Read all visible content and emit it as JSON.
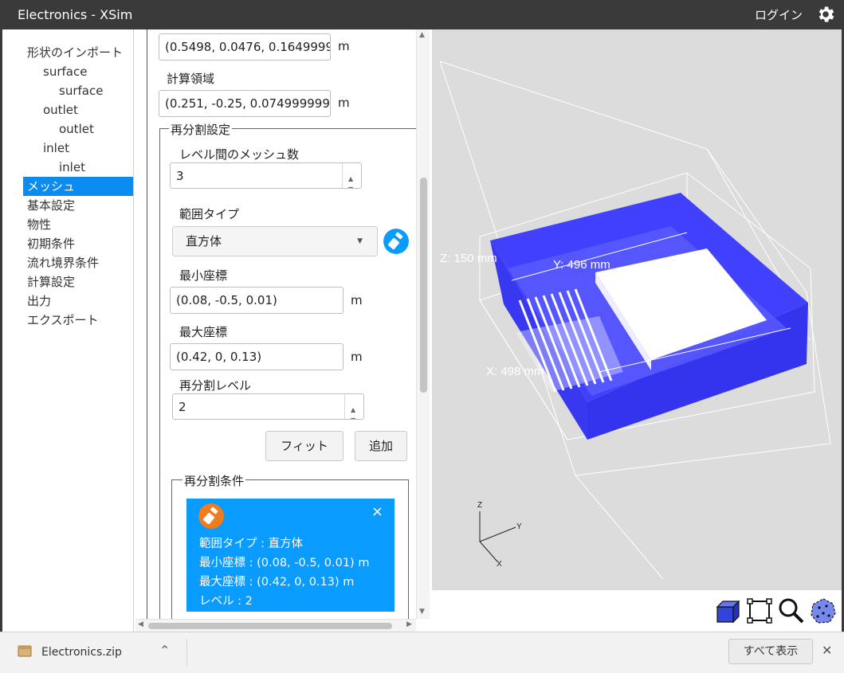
{
  "window": {
    "title": "Electronics - XSim",
    "login_label": "ログイン",
    "settings_icon": "gear-icon"
  },
  "sidebar": {
    "items": [
      {
        "label": "形状のインポート",
        "level": 0
      },
      {
        "label": "surface",
        "level": 1
      },
      {
        "label": "surface",
        "level": 2
      },
      {
        "label": "outlet",
        "level": 1
      },
      {
        "label": "outlet",
        "level": 2
      },
      {
        "label": "inlet",
        "level": 1
      },
      {
        "label": "inlet",
        "level": 2
      },
      {
        "label": "メッシュ",
        "level": 0,
        "selected": true
      },
      {
        "label": "基本設定",
        "level": 0
      },
      {
        "label": "物性",
        "level": 0
      },
      {
        "label": "初期条件",
        "level": 0
      },
      {
        "label": "流れ境界条件",
        "level": 0
      },
      {
        "label": "計算設定",
        "level": 0
      },
      {
        "label": "出力",
        "level": 0
      },
      {
        "label": "エクスポート",
        "level": 0
      }
    ]
  },
  "panel": {
    "point_value": "(0.5498, 0.0476, 0.16499999",
    "point_unit": "m",
    "domain_label": "計算領域",
    "domain_value": "(0.251, -0.25, 0.0749999999",
    "domain_unit": "m",
    "refine": {
      "legend": "再分割設定",
      "mesh_count_label": "レベル間のメッシュ数",
      "mesh_count_value": "3",
      "range_type_label": "範囲タイプ",
      "range_type_value": "直方体",
      "min_label": "最小座標",
      "min_value": "(0.08, -0.5, 0.01)",
      "min_unit": "m",
      "max_label": "最大座標",
      "max_value": "(0.42, 0, 0.13)",
      "max_unit": "m",
      "level_label": "再分割レベル",
      "level_value": "2",
      "fit_button": "フィット",
      "add_button": "追加"
    },
    "conditions": {
      "legend": "再分割条件",
      "card": {
        "type_line": "範囲タイプ : 直方体",
        "min_line": "最小座標 : (0.08, -0.5, 0.01) m",
        "max_line": "最大座標 : (0.42, 0, 0.13) m",
        "level_line": "レベル : 2",
        "close": "×"
      }
    }
  },
  "viewport": {
    "z_dim": "Z: 150 mm",
    "y_dim": "Y: 496 mm",
    "x_dim": "X: 498 mm",
    "axis_z": "Z",
    "axis_y": "Y",
    "axis_x": "X",
    "model_color": "#3333ff",
    "background": "#dcdcdc"
  },
  "toolbar": {
    "tools": [
      "cube-view-icon",
      "fit-frame-icon",
      "zoom-icon",
      "sphere-mesh-icon"
    ]
  },
  "download": {
    "filename": "Electronics.zip",
    "show_all": "すべて表示",
    "close": "✕"
  }
}
